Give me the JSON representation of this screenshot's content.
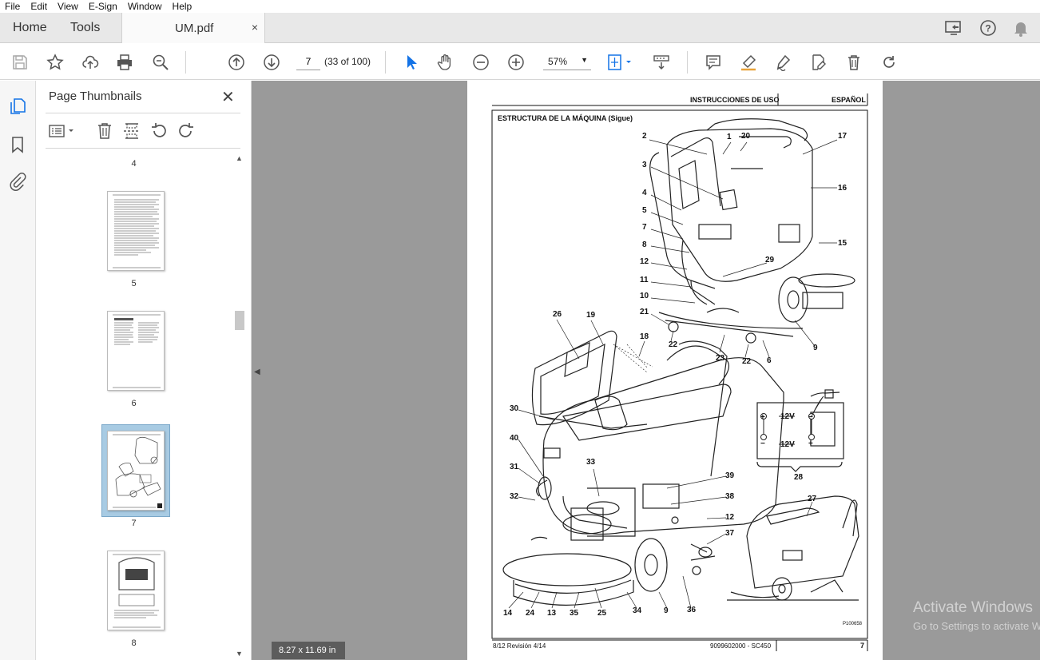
{
  "menu": [
    "File",
    "Edit",
    "View",
    "E-Sign",
    "Window",
    "Help"
  ],
  "tabs": {
    "home": "Home",
    "tools": "Tools",
    "document": "UM.pdf",
    "close": "×"
  },
  "toolbar": {
    "page_current": "7",
    "page_count": "(33 of 100)",
    "zoom": "57%"
  },
  "panel": {
    "title": "Page Thumbnails",
    "close": "✕",
    "thumbnails": [
      {
        "label": "4"
      },
      {
        "label": "5"
      },
      {
        "label": "6"
      },
      {
        "label": "7",
        "selected": true
      },
      {
        "label": "8"
      }
    ]
  },
  "status": {
    "page_size": "8.27 x 11.69 in"
  },
  "watermark": {
    "line1": "Activate Windows",
    "line2": "Go to Settings to activate Windows."
  },
  "doc_page": {
    "header_left": "INSTRUCCIONES DE USO",
    "header_right": "ESPAÑOL",
    "section_title": "ESTRUCTURA DE LA MÁQUINA (Sigue)",
    "footer_left": "8/12 Revisión 4/14",
    "footer_center": "9099602000 - SC450",
    "footer_right": "7",
    "figure_code": "P100658",
    "battery_label": "12V",
    "battery_plus": "+",
    "battery_minus": "−",
    "callouts": [
      "2",
      "1",
      "20",
      "17",
      "3",
      "16",
      "4",
      "5",
      "15",
      "7",
      "8",
      "29",
      "12",
      "11",
      "10",
      "21",
      "22",
      "23",
      "22",
      "6",
      "9",
      "26",
      "19",
      "18",
      "30",
      "40",
      "31",
      "32",
      "33",
      "39",
      "38",
      "12",
      "37",
      "14",
      "24",
      "13",
      "35",
      "25",
      "34",
      "9",
      "36",
      "28",
      "27"
    ]
  },
  "colors": {
    "accent": "#1473e6",
    "selection": "#a8cbe3",
    "doc_bg": "#9a9a9a"
  }
}
